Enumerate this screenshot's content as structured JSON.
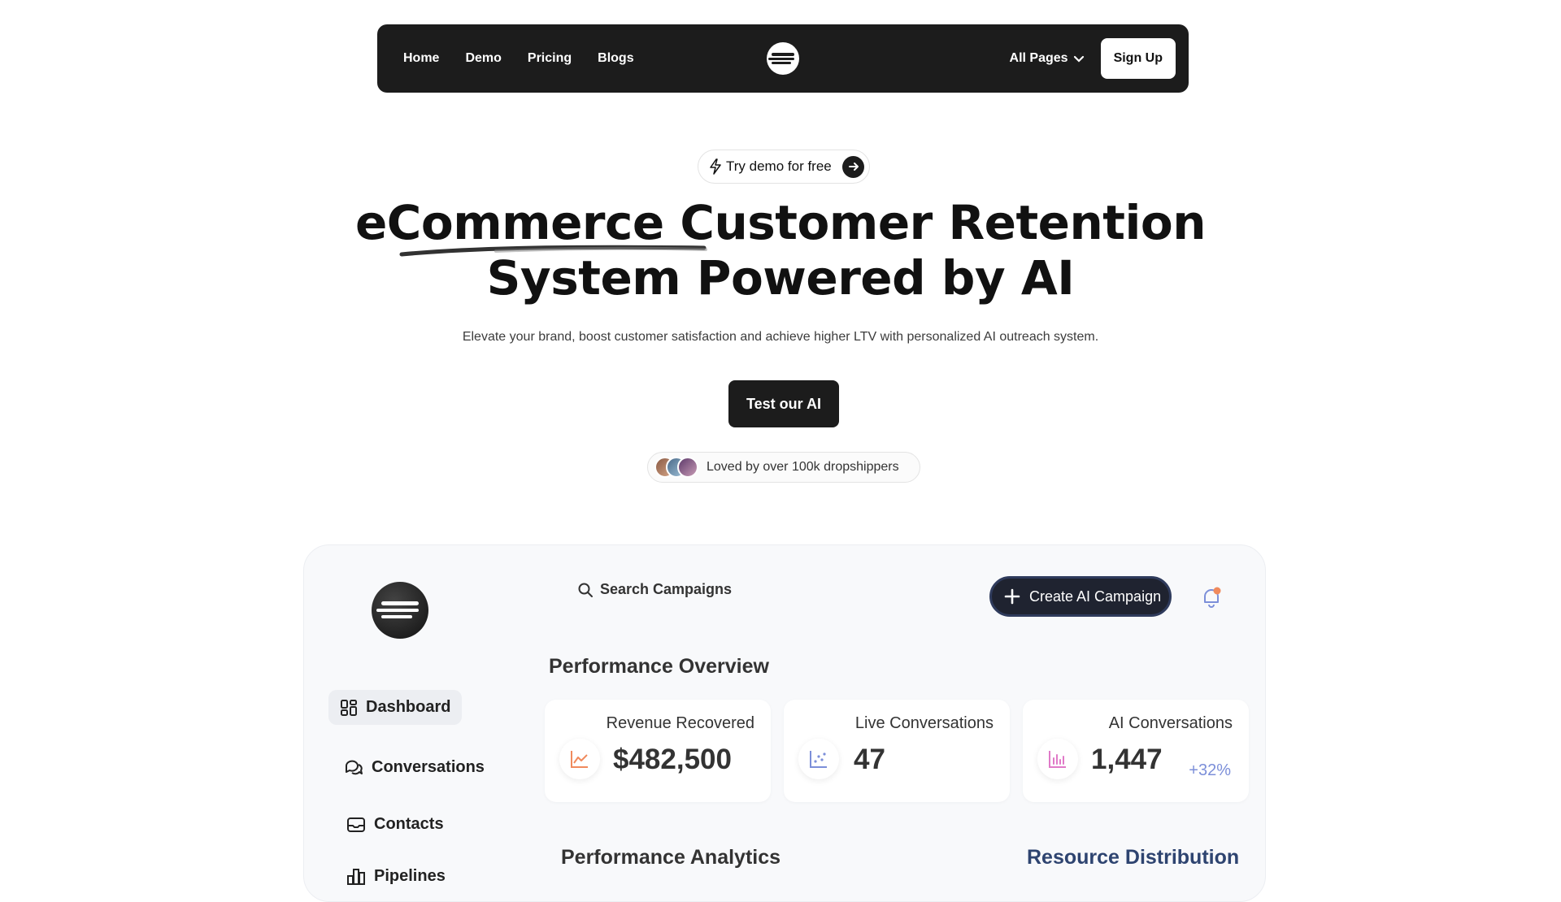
{
  "nav": {
    "links": [
      "Home",
      "Demo",
      "Pricing",
      "Blogs"
    ],
    "all_pages": "All Pages",
    "sign_up": "Sign Up"
  },
  "hero": {
    "badge": "Try demo for free",
    "headline_line1_highlight": "eCommerce",
    "headline_line1_rest": " Customer Retention",
    "headline_line2": "System Powered by AI",
    "subtitle": "Elevate your brand, boost customer satisfaction and achieve higher LTV with personalized AI outreach system.",
    "cta": "Test our AI",
    "social_proof": "Loved by over 100k dropshippers"
  },
  "dashboard": {
    "search_placeholder": "Search Campaigns",
    "create_button": "Create AI Campaign",
    "sidebar": [
      "Dashboard",
      "Conversations",
      "Contacts",
      "Pipelines"
    ],
    "performance_overview": "Performance Overview",
    "cards": [
      {
        "label": "Revenue Recovered",
        "value": "$482,500",
        "change": "",
        "icon": "area-chart-icon"
      },
      {
        "label": "Live Conversations",
        "value": "47",
        "change": "",
        "icon": "scatter-chart-icon"
      },
      {
        "label": "AI Conversations",
        "value": "1,447",
        "change": "+32%",
        "icon": "bar-chart-icon"
      }
    ],
    "performance_analytics": "Performance Analytics",
    "resource_distribution": "Resource Distribution"
  },
  "colors": {
    "nav_bg": "#1c1c1c",
    "accent_change": "#7c8fd9",
    "resource_title": "#2e4470"
  }
}
